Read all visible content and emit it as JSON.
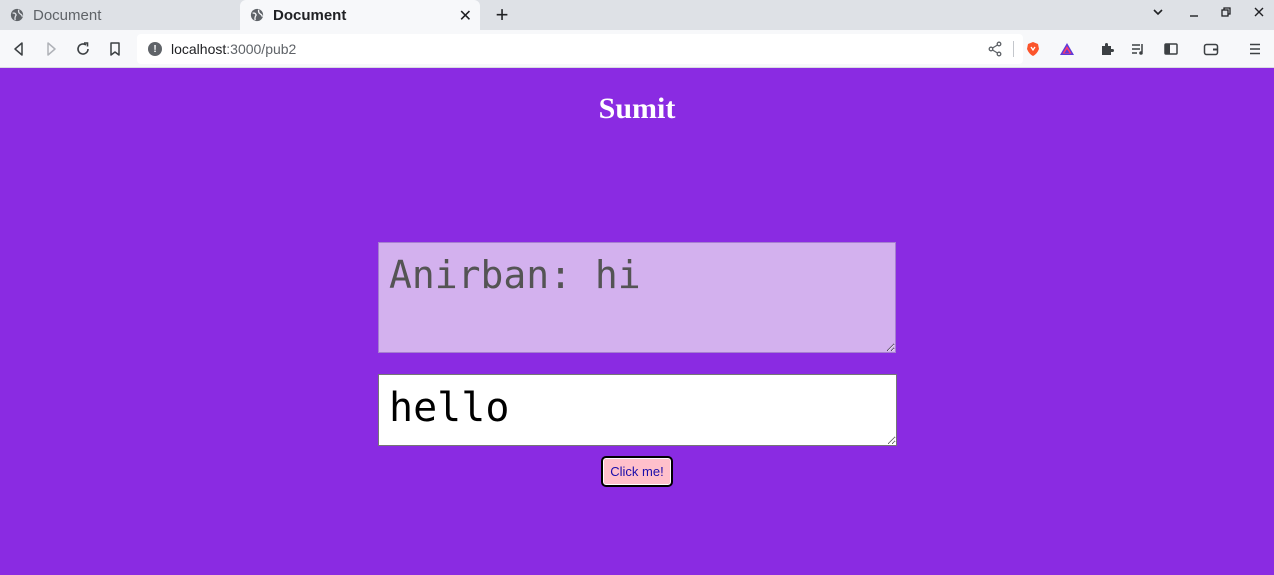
{
  "browser": {
    "tabs": [
      {
        "title": "Document",
        "active": false
      },
      {
        "title": "Document",
        "active": true
      }
    ],
    "new_tab_glyph": "+",
    "close_glyph": "✕",
    "url_host": "localhost",
    "url_path": ":3000/pub2",
    "icons": [
      "back-icon",
      "forward-icon",
      "reload-icon",
      "bookmark-icon",
      "info-icon",
      "share-icon",
      "brave-shield-icon",
      "brave-rewards-icon",
      "extensions-icon",
      "media-queue-icon",
      "sidebar-icon",
      "wallet-icon",
      "menu-icon"
    ]
  },
  "page": {
    "title": "Sumit",
    "received_text": "Anirban: hi",
    "input_value": "hello",
    "button_label": "Click me!"
  },
  "colors": {
    "page_background": "#8a2be2",
    "received_background": "#d3b1ee",
    "button_background": "#ffc0cb"
  }
}
